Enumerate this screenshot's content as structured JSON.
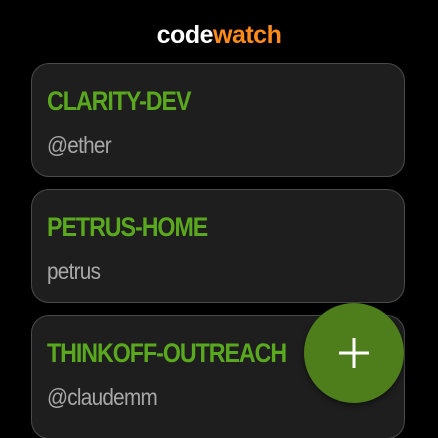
{
  "app": {
    "title_part1": "code",
    "title_part2": "watch",
    "title_color_primary": "#ffffff",
    "title_color_accent": "#ff8c1a"
  },
  "accounts": [
    {
      "name": "CLARITY-DEV",
      "user": "@ether"
    },
    {
      "name": "PETRUS-HOME",
      "user": "petrus"
    },
    {
      "name": "THINKOFF-OUTREACH",
      "user": "@claudemm"
    }
  ],
  "fab": {
    "icon": "plus-icon",
    "color": "#4e7d1b"
  },
  "colors": {
    "background": "#000000",
    "card_background": "#1e1e1e",
    "card_border": "#4a4a4a",
    "account_name": "#5aa81e",
    "account_user": "#a8a8a8"
  }
}
